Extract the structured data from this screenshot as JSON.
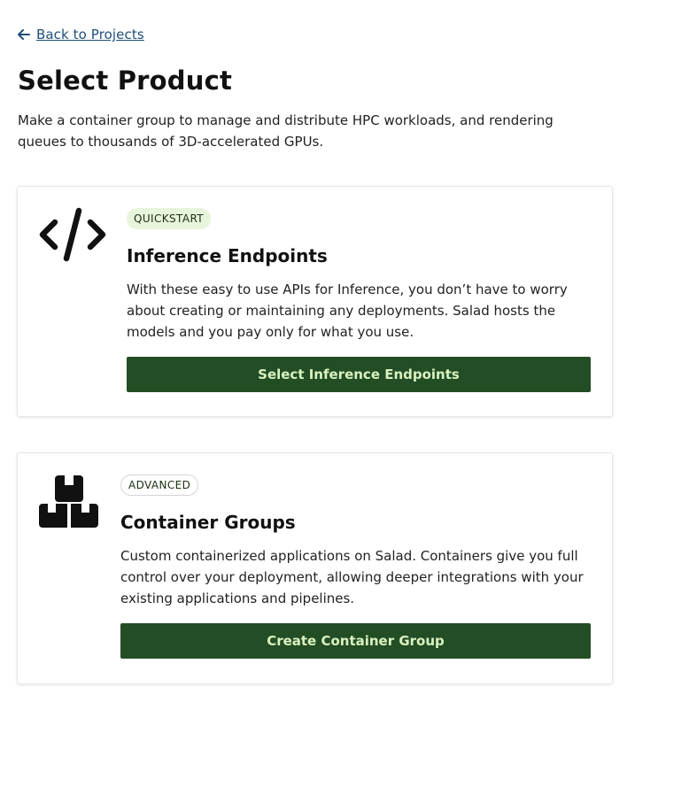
{
  "nav": {
    "back_label": "Back to Projects",
    "back_icon": "arrow-left-icon"
  },
  "page": {
    "title": "Select Product",
    "description": "Make a container group to manage and distribute HPC workloads, and rendering queues to thousands of 3D-accelerated GPUs."
  },
  "products": [
    {
      "icon": "code-icon",
      "badge": "QUICKSTART",
      "title": "Inference Endpoints",
      "description": "With these easy to use APIs for Inference, you don’t have to worry about creating or maintaining any deployments. Salad hosts the models and you pay only for what you use.",
      "button_label": "Select Inference Endpoints"
    },
    {
      "icon": "boxes-icon",
      "badge": "ADVANCED",
      "title": "Container Groups",
      "description": "Custom containerized applications on Salad. Containers give you full control over your deployment, allowing deeper integrations with your existing applications and pipelines.",
      "button_label": "Create Container Group"
    }
  ],
  "colors": {
    "button_bg": "#234d25",
    "button_text": "#d9f2bf",
    "quickstart_badge_bg": "#e7f5dc",
    "link": "#1f4e79"
  }
}
